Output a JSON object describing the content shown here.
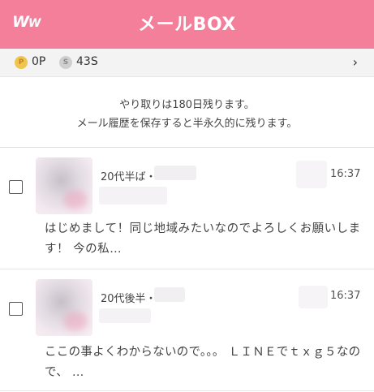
{
  "header": {
    "logo_main": "W",
    "logo_small": "W",
    "title": "メールBOX"
  },
  "points": {
    "p_symbol": "P",
    "p_value": "0P",
    "s_symbol": "S",
    "s_value": "43S",
    "chevron": "›"
  },
  "notice": {
    "line1": "やり取りは180日残ります。",
    "line2": "メール履歴を保存すると半永久的に残ります。"
  },
  "messages": [
    {
      "age": "20代半ば・",
      "time": "16:37",
      "preview": "はじめまして！同じ地域みたいなのでよろしくお願いします！ 今の私…"
    },
    {
      "age": "20代後半・",
      "time": "16:37",
      "preview": "ここの事よくわからないので。。。 ＬＩＮＥでｔｘｇ５なので、 …"
    }
  ],
  "colors": {
    "header_bg": "#f37f9a",
    "points_bg": "#f3f3f3",
    "coin_p": "#f0c54d",
    "coin_s": "#cfcfcf"
  }
}
